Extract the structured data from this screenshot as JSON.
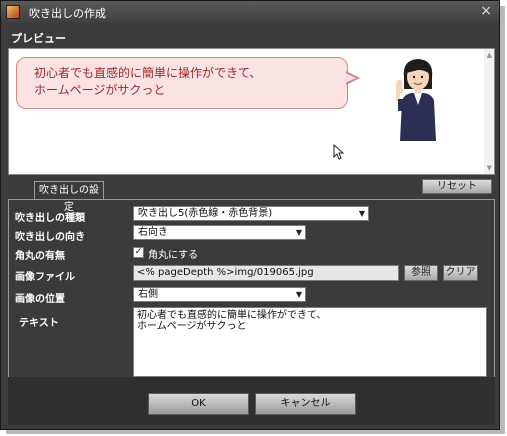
{
  "window": {
    "title": "吹き出しの作成",
    "close_glyph": "×"
  },
  "preview": {
    "label": "プレビュー",
    "bubble_text": "初心者でも直感的に簡単に操作ができて、\nホームページがサクっと",
    "bubble_fill": "#fbe3e3",
    "bubble_border": "#d08a8a",
    "text_color": "#9a2a2a"
  },
  "tabs": [
    {
      "label": "吹き出しの設定"
    }
  ],
  "reset_label": "リセット",
  "form": {
    "type": {
      "label": "吹き出しの種類",
      "value": "吹き出し5(赤色線・赤色背景)"
    },
    "direction": {
      "label": "吹き出しの向き",
      "value": "右向き"
    },
    "rounded": {
      "label": "角丸の有無",
      "checkbox_label": "角丸にする",
      "checked": true,
      "check_glyph": "✓"
    },
    "image_file": {
      "label": "画像ファイル",
      "value": "<% pageDepth %>img/019065.jpg",
      "browse_label": "参照",
      "clear_label": "クリア"
    },
    "image_position": {
      "label": "画像の位置",
      "value": "右側"
    },
    "text": {
      "label": "テキスト",
      "value": "初心者でも直感的に簡単に操作ができて、\nホームページがサクっと"
    }
  },
  "buttons": {
    "ok": "OK",
    "cancel": "キャンセル"
  }
}
